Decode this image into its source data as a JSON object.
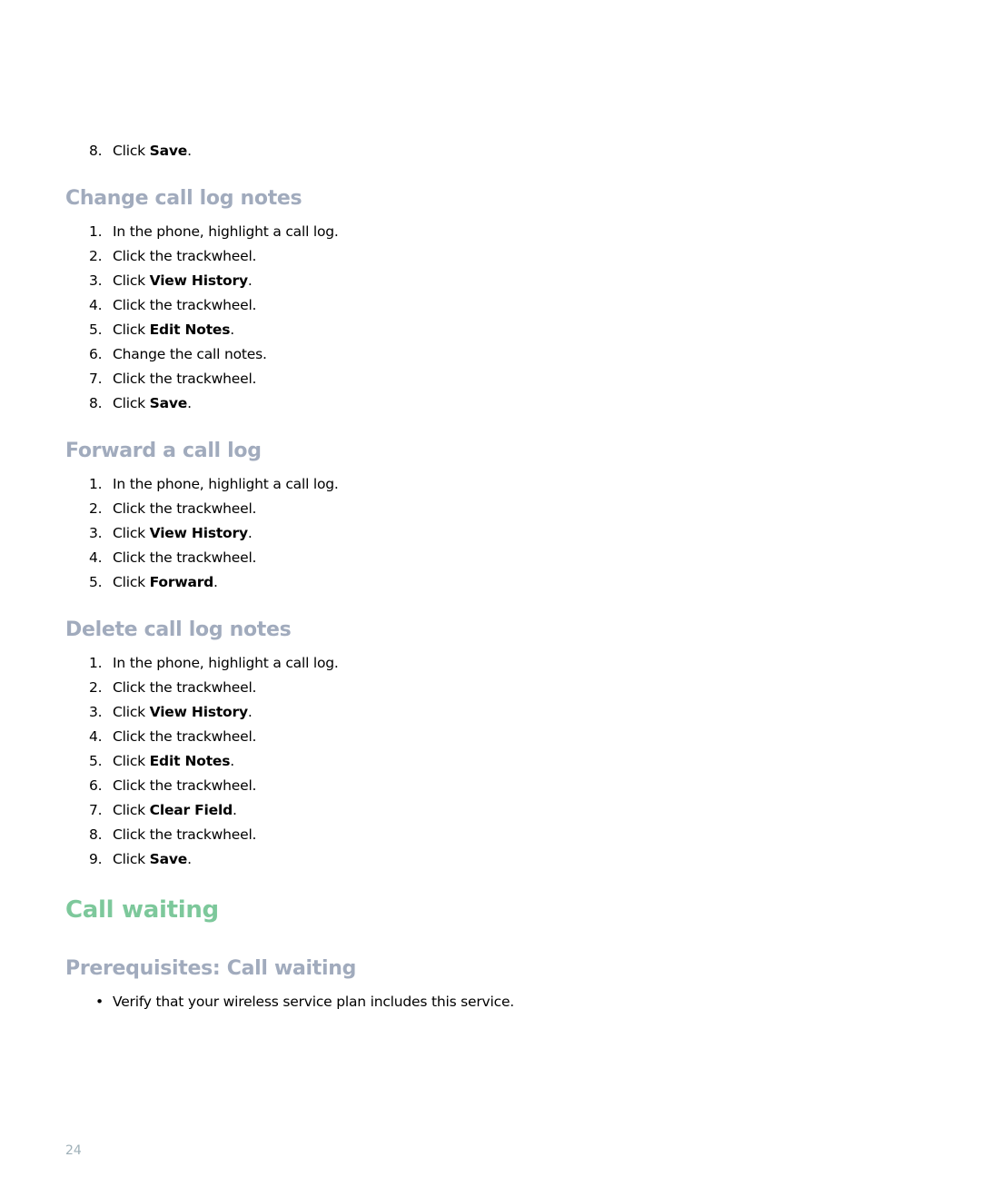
{
  "document": {
    "page_number": "24",
    "accent_colors": {
      "heading_section": "#a1abbd",
      "heading_chapter": "#7dc89b",
      "page_number": "#9fb0b8"
    },
    "prior_steps": [
      {
        "num": "8.",
        "prefix": "Click ",
        "bold": "Save",
        "suffix": "."
      }
    ],
    "sections": [
      {
        "title": "Change call log notes",
        "steps": [
          {
            "num": "1.",
            "prefix": "In the phone, highlight a call log.",
            "bold": "",
            "suffix": ""
          },
          {
            "num": "2.",
            "prefix": "Click the trackwheel.",
            "bold": "",
            "suffix": ""
          },
          {
            "num": "3.",
            "prefix": "Click ",
            "bold": "View History",
            "suffix": "."
          },
          {
            "num": "4.",
            "prefix": "Click the trackwheel.",
            "bold": "",
            "suffix": ""
          },
          {
            "num": "5.",
            "prefix": "Click ",
            "bold": "Edit Notes",
            "suffix": "."
          },
          {
            "num": "6.",
            "prefix": "Change the call notes.",
            "bold": "",
            "suffix": ""
          },
          {
            "num": "7.",
            "prefix": "Click the trackwheel.",
            "bold": "",
            "suffix": ""
          },
          {
            "num": "8.",
            "prefix": "Click ",
            "bold": "Save",
            "suffix": "."
          }
        ]
      },
      {
        "title": "Forward a call log",
        "steps": [
          {
            "num": "1.",
            "prefix": "In the phone, highlight a call log.",
            "bold": "",
            "suffix": ""
          },
          {
            "num": "2.",
            "prefix": "Click the trackwheel.",
            "bold": "",
            "suffix": ""
          },
          {
            "num": "3.",
            "prefix": "Click ",
            "bold": "View History",
            "suffix": "."
          },
          {
            "num": "4.",
            "prefix": "Click the trackwheel.",
            "bold": "",
            "suffix": ""
          },
          {
            "num": "5.",
            "prefix": "Click ",
            "bold": "Forward",
            "suffix": "."
          }
        ]
      },
      {
        "title": "Delete call log notes",
        "steps": [
          {
            "num": "1.",
            "prefix": "In the phone, highlight a call log.",
            "bold": "",
            "suffix": ""
          },
          {
            "num": "2.",
            "prefix": "Click the trackwheel.",
            "bold": "",
            "suffix": ""
          },
          {
            "num": "3.",
            "prefix": "Click ",
            "bold": "View History",
            "suffix": "."
          },
          {
            "num": "4.",
            "prefix": "Click the trackwheel.",
            "bold": "",
            "suffix": ""
          },
          {
            "num": "5.",
            "prefix": "Click ",
            "bold": "Edit Notes",
            "suffix": "."
          },
          {
            "num": "6.",
            "prefix": "Click the trackwheel.",
            "bold": "",
            "suffix": ""
          },
          {
            "num": "7.",
            "prefix": "Click ",
            "bold": "Clear Field",
            "suffix": "."
          },
          {
            "num": "8.",
            "prefix": "Click the trackwheel.",
            "bold": "",
            "suffix": ""
          },
          {
            "num": "9.",
            "prefix": "Click ",
            "bold": "Save",
            "suffix": "."
          }
        ]
      }
    ],
    "chapter": {
      "title": "Call waiting",
      "subsection": {
        "title": "Prerequisites: Call waiting",
        "bullet_symbol": "•",
        "bullets": [
          "Verify that your wireless service plan includes this service."
        ]
      }
    }
  }
}
